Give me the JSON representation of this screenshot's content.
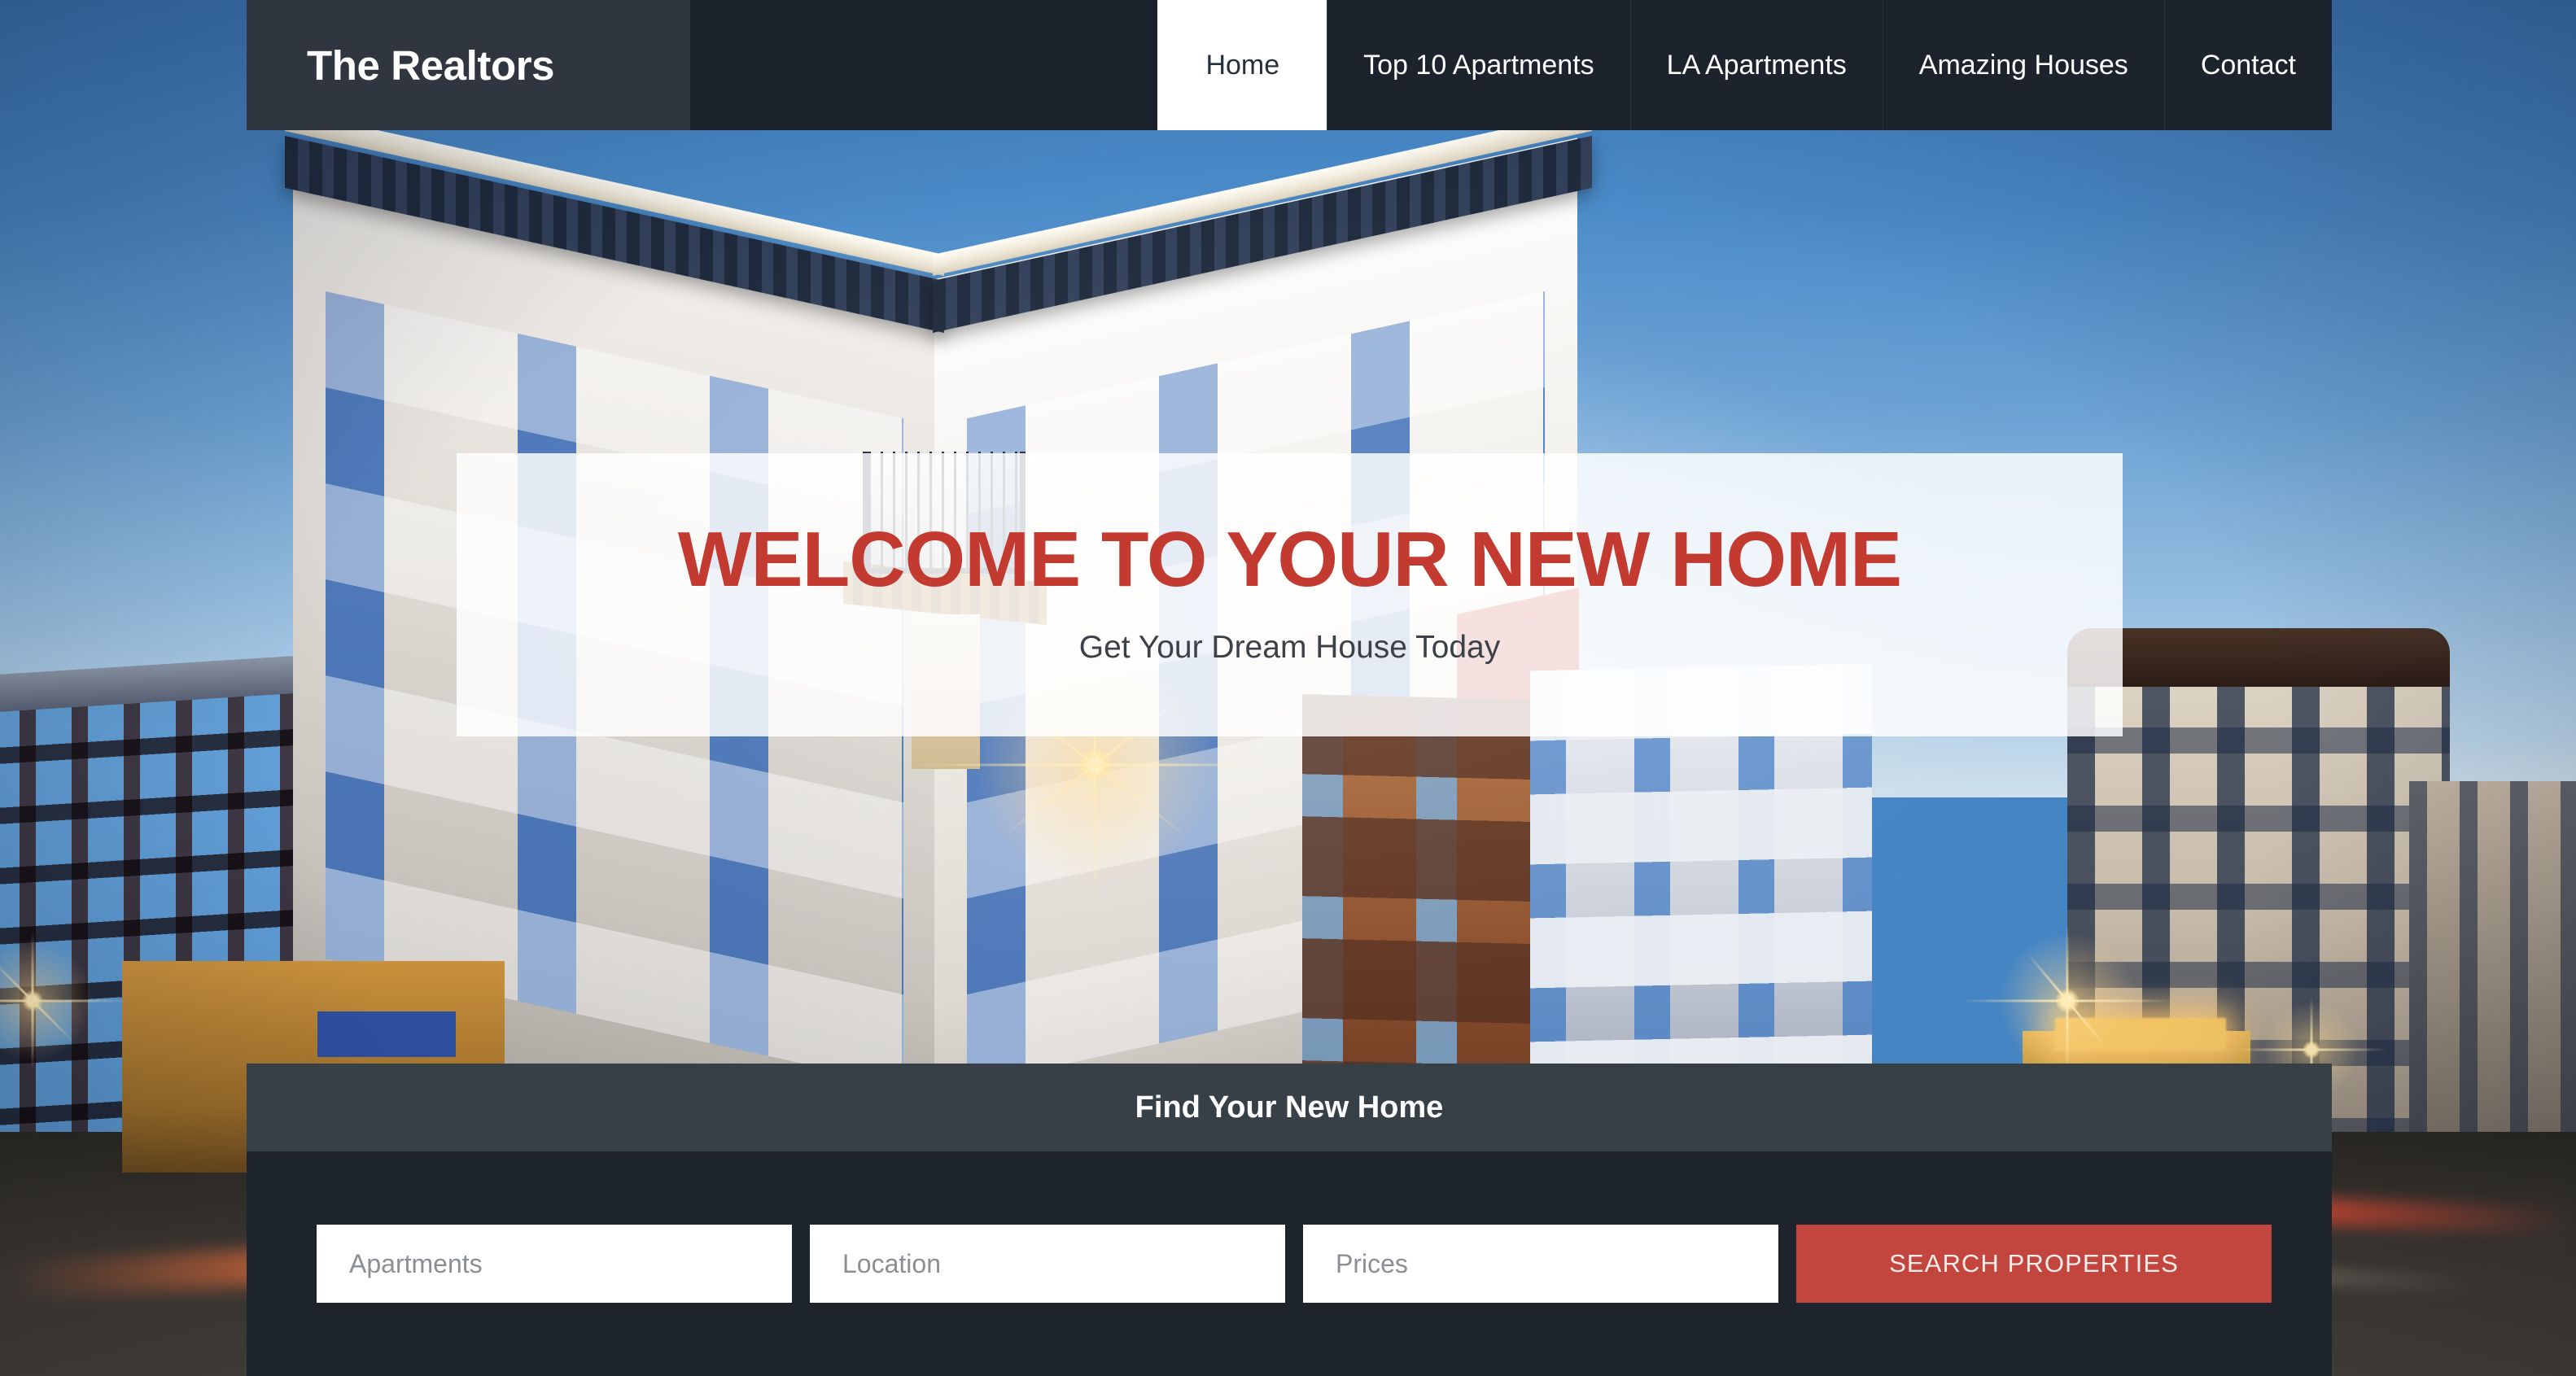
{
  "brand": {
    "name": "The Realtors"
  },
  "nav": {
    "items": [
      {
        "label": "Home",
        "active": true
      },
      {
        "label": "Top 10 Apartments",
        "active": false
      },
      {
        "label": "LA Apartments",
        "active": false
      },
      {
        "label": "Amazing Houses",
        "active": false
      },
      {
        "label": "Contact",
        "active": false
      }
    ]
  },
  "hero": {
    "title": "WELCOME TO YOUR NEW HOME",
    "subtitle": "Get Your Dream House Today"
  },
  "search": {
    "heading": "Find Your New Home",
    "fields": [
      {
        "name": "apartments",
        "placeholder": "Apartments",
        "value": ""
      },
      {
        "name": "location",
        "placeholder": "Location",
        "value": ""
      },
      {
        "name": "prices",
        "placeholder": "Prices",
        "value": ""
      }
    ],
    "submit_label": "SEARCH PROPERTIES"
  },
  "colors": {
    "nav_bg": "#1c232d",
    "brand_bg": "#2f3640",
    "accent_red": "#c2453e",
    "heading_red": "#c33a30",
    "find_head_bg": "#373f47",
    "find_body_bg": "#1e242c",
    "sky_blue": "#4585c4"
  }
}
